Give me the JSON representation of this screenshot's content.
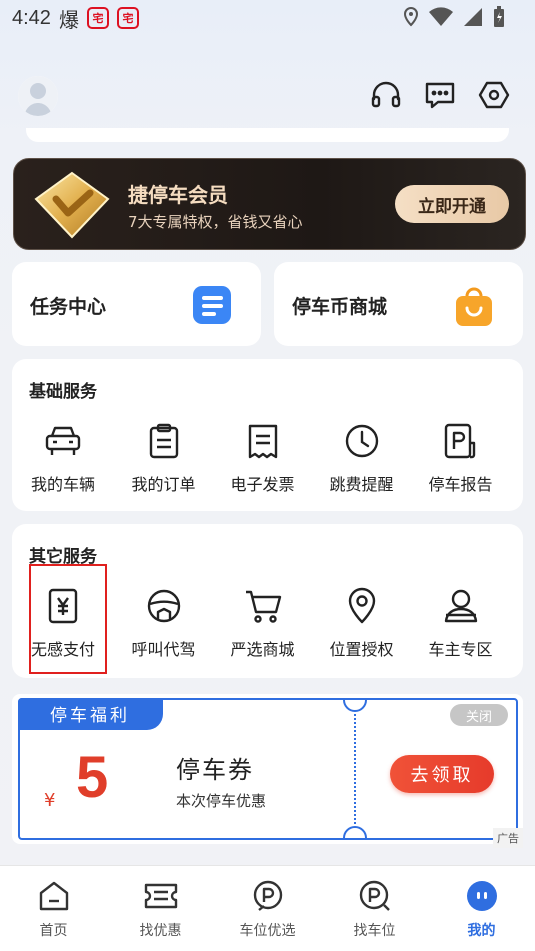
{
  "status_bar": {
    "time": "4:42",
    "glyph": "爆",
    "badge1": "宅",
    "badge2": "宅"
  },
  "header": {
    "avatar_icon": "user-avatar-icon",
    "icons": [
      "headset-icon",
      "message-icon",
      "settings-icon"
    ]
  },
  "vip": {
    "title": "捷停车会员",
    "subtitle": "7大专属特权，省钱又省心",
    "button": "立即开通"
  },
  "quick": {
    "task_center": "任务中心",
    "coin_mall": "停车币商城"
  },
  "basic_services": {
    "title": "基础服务",
    "items": [
      {
        "label": "我的车辆",
        "icon": "car-icon"
      },
      {
        "label": "我的订单",
        "icon": "order-icon"
      },
      {
        "label": "电子发票",
        "icon": "invoice-icon"
      },
      {
        "label": "跳费提醒",
        "icon": "clock-icon"
      },
      {
        "label": "停车报告",
        "icon": "parking-report-icon"
      }
    ]
  },
  "other_services": {
    "title": "其它服务",
    "items": [
      {
        "label": "无感支付",
        "icon": "yen-payment-icon"
      },
      {
        "label": "呼叫代驾",
        "icon": "steering-wheel-icon"
      },
      {
        "label": "严选商城",
        "icon": "cart-icon"
      },
      {
        "label": "位置授权",
        "icon": "location-pin-icon"
      },
      {
        "label": "车主专区",
        "icon": "driver-icon"
      }
    ]
  },
  "coupon": {
    "tag": "停车福利",
    "close": "关闭",
    "yen": "¥",
    "amount": "5",
    "name": "停车券",
    "desc": "本次停车优惠",
    "button": "去领取",
    "ad_label": "广告"
  },
  "tabs": [
    {
      "label": "首页",
      "icon": "home-icon",
      "active": false
    },
    {
      "label": "找优惠",
      "icon": "coupon-icon",
      "active": false
    },
    {
      "label": "车位优选",
      "icon": "spot-icon",
      "active": false
    },
    {
      "label": "找车位",
      "icon": "parking-icon",
      "active": false
    },
    {
      "label": "我的",
      "icon": "profile-icon",
      "active": true
    }
  ],
  "colors": {
    "accent": "#2f6ee0",
    "red": "#e03e2a",
    "highlight": "#e0201e",
    "vip_bg": "#1e1815"
  }
}
